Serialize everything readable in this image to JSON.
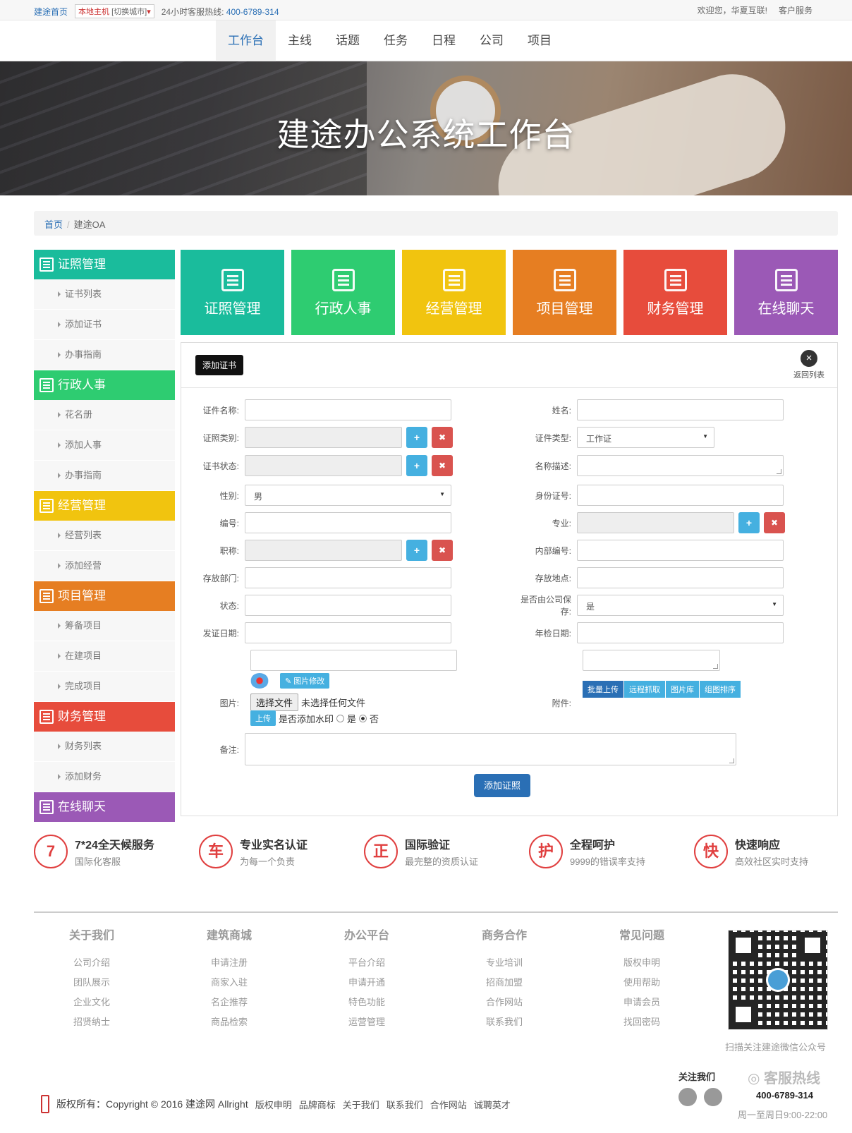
{
  "topbar": {
    "home": "建途首页",
    "city_host": "本地主机",
    "city_switch": "[切换城市]",
    "hotline_label": "24小时客服热线:",
    "hotline": "400-6789-314",
    "welcome": "欢迎您，华夏互联!",
    "service": "客户服务"
  },
  "nav": [
    "工作台",
    "主线",
    "话题",
    "任务",
    "日程",
    "公司",
    "项目"
  ],
  "banner": {
    "title": "建途办公系统工作台"
  },
  "breadcrumb": {
    "home": "首页",
    "current": "建途OA"
  },
  "sidebar": [
    {
      "title": "证照管理",
      "color": "#1abc9c",
      "items": [
        "证书列表",
        "添加证书",
        "办事指南"
      ]
    },
    {
      "title": "行政人事",
      "color": "#2ecc71",
      "items": [
        "花名册",
        "添加人事",
        "办事指南"
      ]
    },
    {
      "title": "经营管理",
      "color": "#f1c40f",
      "items": [
        "经营列表",
        "添加经营"
      ]
    },
    {
      "title": "项目管理",
      "color": "#e67e22",
      "items": [
        "筹备项目",
        "在建项目",
        "完成项目"
      ]
    },
    {
      "title": "财务管理",
      "color": "#e74c3c",
      "items": [
        "财务列表",
        "添加财务"
      ]
    },
    {
      "title": "在线聊天",
      "color": "#9b59b6",
      "items": []
    }
  ],
  "tiles": [
    {
      "label": "证照管理",
      "color": "#1abc9c"
    },
    {
      "label": "行政人事",
      "color": "#2ecc71"
    },
    {
      "label": "经营管理",
      "color": "#f1c40f"
    },
    {
      "label": "项目管理",
      "color": "#e67e22"
    },
    {
      "label": "财务管理",
      "color": "#e74c3c"
    },
    {
      "label": "在线聊天",
      "color": "#9b59b6"
    }
  ],
  "form": {
    "tag": "添加证书",
    "back": "返回列表",
    "cert_name": "证件名称:",
    "name": "姓名:",
    "cert_category": "证照类别:",
    "cert_type": "证件类型:",
    "cert_type_value": "工作证",
    "cert_status": "证书状态:",
    "name_desc": "名称描述:",
    "gender": "性别:",
    "gender_value": "男",
    "id_number": "身份证号:",
    "number": "编号:",
    "major": "专业:",
    "title": "职称:",
    "internal_number": "内部编号:",
    "storage_dept": "存放部门:",
    "storage_place": "存放地点:",
    "status": "状态:",
    "company_keep": "是否由公司保存:",
    "company_keep_value": "是",
    "issue_date": "发证日期:",
    "annual_date": "年检日期:",
    "image": "图片:",
    "image_edit": "图片修改",
    "choose_file": "选择文件",
    "no_file": "未选择任何文件",
    "upload": "上传",
    "watermark": "是否添加水印",
    "yes": "是",
    "no": "否",
    "attachment": "附件:",
    "attach_btns": [
      "批量上传",
      "远程抓取",
      "图片库",
      "组图排序"
    ],
    "remark": "备注:",
    "submit": "添加证照"
  },
  "features": [
    {
      "icon": "7",
      "title": "7*24全天候服务",
      "desc": "国际化客服"
    },
    {
      "icon": "车",
      "title": "专业实名认证",
      "desc": "为每一个负责"
    },
    {
      "icon": "正",
      "title": "国际验证",
      "desc": "最完整的资质认证"
    },
    {
      "icon": "护",
      "title": "全程呵护",
      "desc": "9999的错误率支持"
    },
    {
      "icon": "快",
      "title": "快速响应",
      "desc": "高效社区实时支持"
    }
  ],
  "footer_cols": [
    {
      "title": "关于我们",
      "items": [
        "公司介绍",
        "团队展示",
        "企业文化",
        "招贤纳士"
      ]
    },
    {
      "title": "建筑商城",
      "items": [
        "申请注册",
        "商家入驻",
        "名企推荐",
        "商品检索"
      ]
    },
    {
      "title": "办公平台",
      "items": [
        "平台介绍",
        "申请开通",
        "特色功能",
        "运营管理"
      ]
    },
    {
      "title": "商务合作",
      "items": [
        "专业培训",
        "招商加盟",
        "合作网站",
        "联系我们"
      ]
    },
    {
      "title": "常见问题",
      "items": [
        "版权申明",
        "使用帮助",
        "申请会员",
        "找回密码"
      ]
    }
  ],
  "qr_text": "扫描关注建途微信公众号",
  "follow": "关注我们",
  "hotline_title": "客服热线",
  "hotline_number": "400-6789-314",
  "hotline_time": "周一至周日9:00-22:00",
  "copyright": "版权所有：Copyright © 2016 建途网 Allright",
  "footer_links": [
    "版权申明",
    "品牌商标",
    "关于我们",
    "联系我们",
    "合作网站",
    "诚聘英才"
  ]
}
